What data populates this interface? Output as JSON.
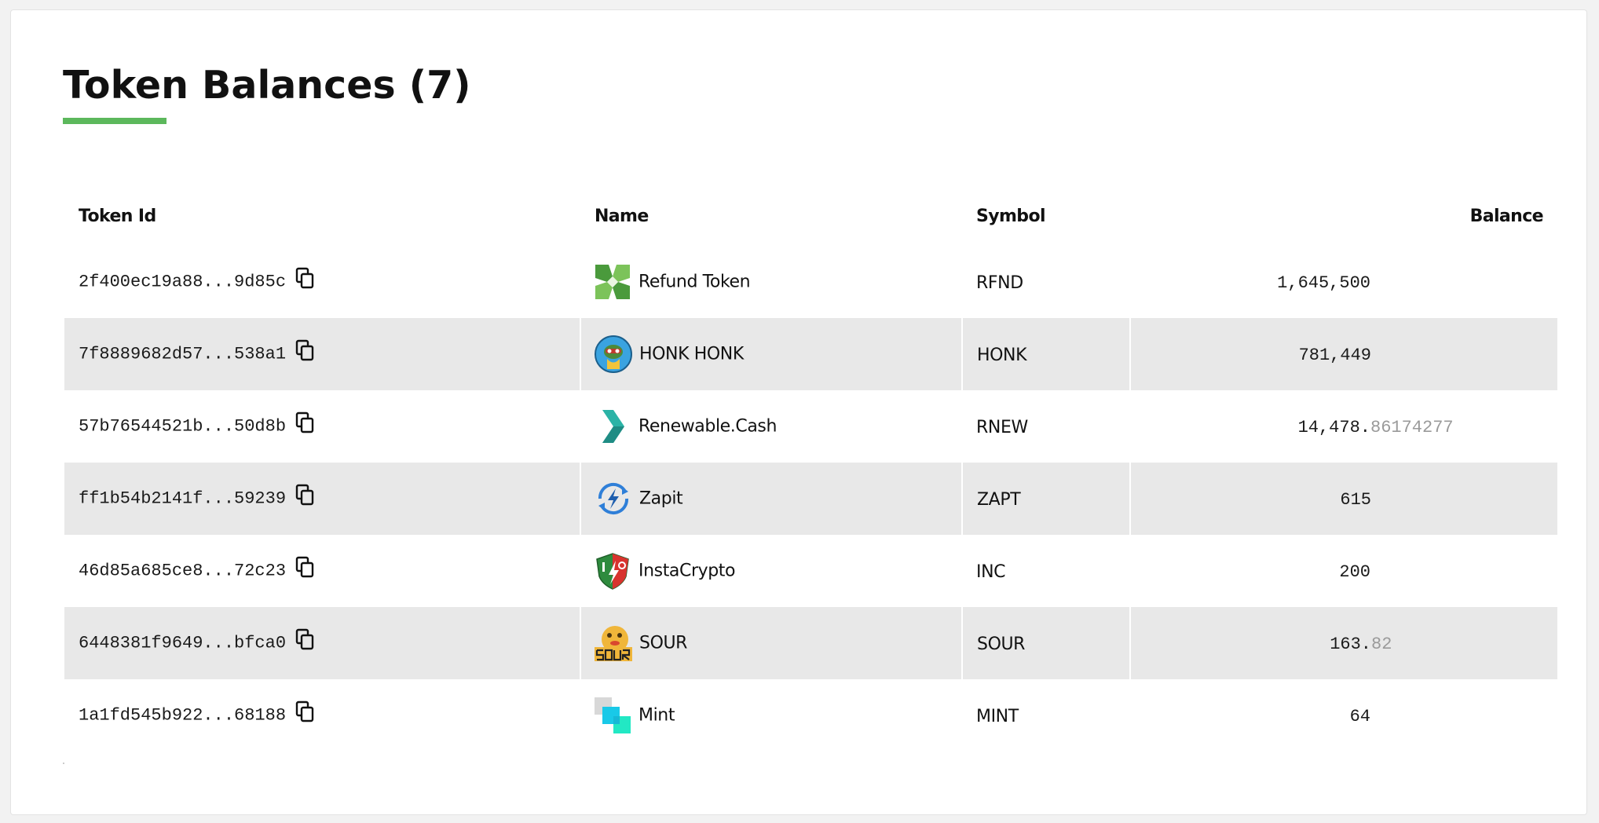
{
  "title": "Token Balances (7)",
  "colors": {
    "accent": "#5cb85c",
    "stripe": "#e8e8e8",
    "fraction_text": "#9a9a9a"
  },
  "table": {
    "headers": {
      "token_id": "Token Id",
      "name": "Name",
      "symbol": "Symbol",
      "balance": "Balance"
    },
    "rows": [
      {
        "token_id": "2f400ec19a88...9d85c",
        "icon": "refund-token-icon",
        "name": "Refund Token",
        "symbol": "RFND",
        "balance_int": "1,645,500",
        "balance_frac": ""
      },
      {
        "token_id": "7f8889682d57...538a1",
        "icon": "honk-honk-icon",
        "name": "HONK HONK",
        "symbol": "HONK",
        "balance_int": "781,449",
        "balance_frac": ""
      },
      {
        "token_id": "57b76544521b...50d8b",
        "icon": "renewable-cash-icon",
        "name": "Renewable.Cash",
        "symbol": "RNEW",
        "balance_int": "14,478.",
        "balance_frac": "86174277"
      },
      {
        "token_id": "ff1b54b2141f...59239",
        "icon": "zapit-icon",
        "name": "Zapit",
        "symbol": "ZAPT",
        "balance_int": "615",
        "balance_frac": ""
      },
      {
        "token_id": "46d85a685ce8...72c23",
        "icon": "instacrypto-icon",
        "name": "InstaCrypto",
        "symbol": "INC",
        "balance_int": "200",
        "balance_frac": ""
      },
      {
        "token_id": "6448381f9649...bfca0",
        "icon": "sour-icon",
        "name": "SOUR",
        "symbol": "SOUR",
        "balance_int": "163.",
        "balance_frac": "82"
      },
      {
        "token_id": "1a1fd545b922...68188",
        "icon": "mint-icon",
        "name": "Mint",
        "symbol": "MINT",
        "balance_int": "64",
        "balance_frac": ""
      }
    ]
  }
}
